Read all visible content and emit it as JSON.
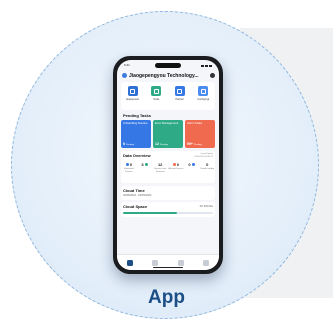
{
  "caption": "App",
  "phone": {
    "status_time": "9:41",
    "header_title": "Jiaogepengyou Technology...",
    "quick_actions": [
      {
        "label": "Equipment",
        "icon": "equipment-icon",
        "color": "#2f6fd6"
      },
      {
        "label": "Tools",
        "icon": "tools-icon",
        "color": "#2eaa86"
      },
      {
        "label": "Partner",
        "icon": "partner-icon",
        "color": "#3578e5"
      },
      {
        "label": "Configmgt",
        "icon": "config-icon",
        "color": "#4a8cf0"
      }
    ],
    "pending_title": "Pending Tasks",
    "tasks": [
      {
        "name": "Unhandling Routine",
        "count": "6",
        "unit": "Pending",
        "color": "#3578e5"
      },
      {
        "name": "Error Management",
        "count": "12",
        "unit": "Pending",
        "color": "#2eaa86"
      },
      {
        "name": "Alarm Tasks",
        "count": "99+",
        "unit": "Pending",
        "color": "#ef6a4e"
      }
    ],
    "overview": {
      "title": "Data Overview",
      "updated_label": "Latest Update",
      "updated_time": "06/01/2023 09:30:12",
      "stats": [
        {
          "value": "0",
          "label": "Exhausted Devices"
        },
        {
          "value": "3",
          "label": ""
        },
        {
          "value": "12",
          "label": "Devices to be Removed"
        },
        {
          "value": "0",
          "label": "Affected Devices"
        },
        {
          "value": "0",
          "label": ""
        },
        {
          "value": "0",
          "label": "Revoke an App"
        }
      ]
    },
    "cloud_time": {
      "title": "Cloud Time",
      "range": "02/25/2022 - 04/25/2023"
    },
    "cloud_space": {
      "title": "Cloud Space",
      "value": "0% 60/100G",
      "usage": 0.6
    },
    "tabs": [
      "home-tab",
      "devices-tab",
      "messages-tab",
      "profile-tab"
    ]
  }
}
